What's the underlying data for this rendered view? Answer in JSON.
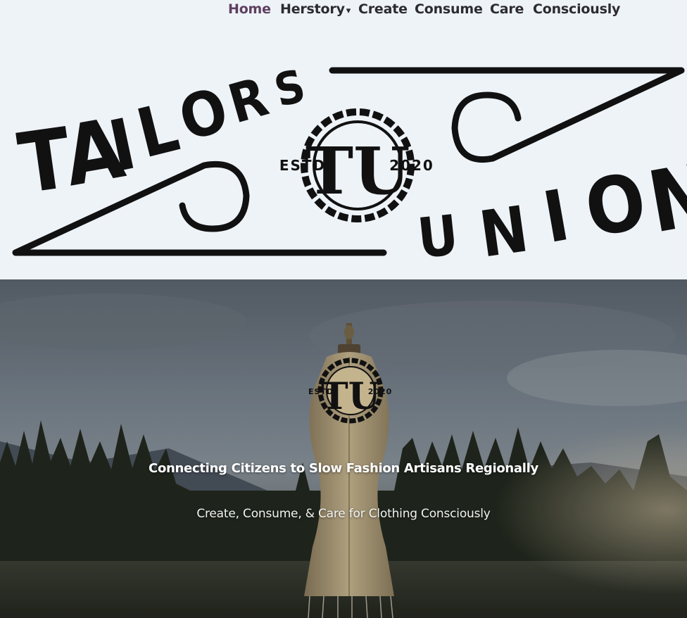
{
  "nav": {
    "items": [
      {
        "label": "Home",
        "active": true
      },
      {
        "label": "Herstory",
        "has_dropdown": true,
        "caret": "▾"
      },
      {
        "label": "Create"
      },
      {
        "label": "Consume"
      },
      {
        "label": "Care"
      },
      {
        "label": "Consciously"
      }
    ]
  },
  "logo": {
    "word_top": [
      "T",
      "A",
      "I",
      "L",
      "O",
      "R",
      "S"
    ],
    "word_bottom": [
      "U",
      "N",
      "I",
      "O",
      "N"
    ],
    "badge_letter": "TU",
    "estd_label": "ESTD",
    "estd_year": "2020"
  },
  "hero": {
    "badge": {
      "estd_label": "ESTD",
      "estd_year": "2020"
    },
    "heading": "Connecting Citizens to Slow Fashion Artisans Regionally",
    "subheading": "Create, Consume, & Care for Clothing Consciously"
  },
  "colors": {
    "page_bg": "#eef3f8",
    "nav_text": "#2b2b30",
    "nav_active": "#5e3f60",
    "logo_ink": "#111111",
    "hero_text": "#ffffff"
  }
}
